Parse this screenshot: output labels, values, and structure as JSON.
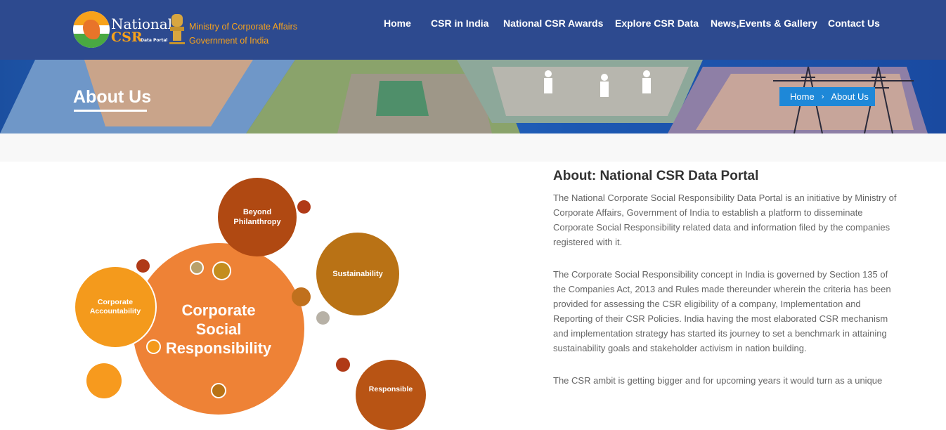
{
  "header": {
    "logo": {
      "word1": "National",
      "word2": "CSR",
      "word3": "Data Portal"
    },
    "ministry_line1": "Ministry of Corporate Affairs",
    "ministry_line2": "Government of India",
    "nav": [
      "Home",
      "CSR in India",
      "National CSR Awards",
      "Explore CSR Data",
      "News,Events & Gallery",
      "Contact Us"
    ]
  },
  "banner": {
    "title": "About Us",
    "breadcrumb": {
      "home": "Home",
      "current": "About Us",
      "separator": "›"
    }
  },
  "graphic": {
    "center": "Corporate Social Responsibility",
    "beyond": "Beyond Philanthropy",
    "sustainability": "Sustainability",
    "accountability": "Corporate Accountability",
    "responsible": "Responsible"
  },
  "content": {
    "title": "About: National CSR Data Portal",
    "p1": "The National Corporate Social Responsibility Data Portal is an initiative by Ministry of Corporate Affairs, Government of India to establish a platform to disseminate Corporate Social Responsibility related data and information filed by the companies registered with it.",
    "p2": "The Corporate Social Responsibility concept in India is governed by Section 135 of the Companies Act, 2013 and Rules made thereunder wherein the criteria has been provided for assessing the CSR eligibility of a company, Implementation and Reporting of their CSR Policies. India having the most elaborated CSR mechanism and implementation strategy has started its journey to set a benchmark in attaining sustainability goals and stakeholder activism in nation building.",
    "p3": "The CSR ambit is getting bigger and for upcoming years it would turn as a unique"
  },
  "colors": {
    "header_bg": "#2d4a8f",
    "accent_orange": "#f7a21b",
    "breadcrumb_bg": "#1e88d8"
  }
}
